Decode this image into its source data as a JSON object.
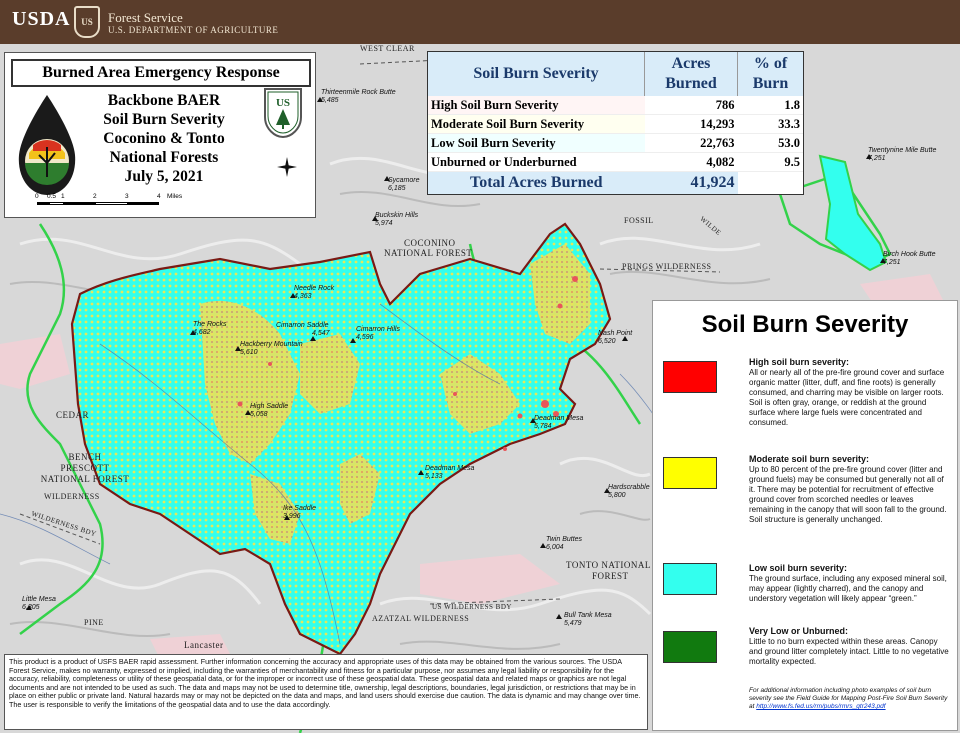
{
  "header": {
    "agency": "USDA",
    "shield_text": "US",
    "forest_service": "Forest Service",
    "department": "U.S. DEPARTMENT OF AGRICULTURE"
  },
  "title_panel": {
    "program": "Burned Area Emergency Response",
    "title_lines": [
      "Backbone BAER",
      "Soil Burn Severity",
      "Coconino & Tonto",
      "National Forests",
      "July 5, 2021"
    ],
    "baer_logo_text": "BURNED AREA EMERGENCY RESPONSE",
    "fs_logo_text": "FOREST SERVICE",
    "scale_labels": [
      "0",
      "0.5",
      "1",
      "2",
      "3",
      "4"
    ],
    "scale_unit": "Miles"
  },
  "severity_table": {
    "headers": [
      "Soil Burn Severity",
      "Acres Burned",
      "% of Burn"
    ],
    "rows": [
      {
        "label": "High Soil Burn Severity",
        "acres": "786",
        "pct": "1.8"
      },
      {
        "label": "Moderate Soil Burn Severity",
        "acres": "14,293",
        "pct": "33.3"
      },
      {
        "label": "Low Soil Burn Severity",
        "acres": "22,763",
        "pct": "53.0"
      },
      {
        "label": "Unburned or Underburned",
        "acres": "4,082",
        "pct": "9.5"
      }
    ],
    "total_label": "Total Acres Burned",
    "total_acres": "41,924"
  },
  "legend": {
    "title": "Soil Burn Severity",
    "items": [
      {
        "color": "#ff0000",
        "heading": "High soil burn severity:",
        "text": "All or nearly all of the pre-fire ground cover and surface organic matter (litter, duff, and fine roots) is generally consumed, and charring may be visible on larger roots. Soil is often gray, orange, or reddish at the ground surface where large fuels were concentrated and consumed."
      },
      {
        "color": "#ffff00",
        "heading": "Moderate soil burn severity:",
        "text": "Up to 80 percent of the pre-fire ground cover (litter and ground fuels) may be consumed but generally not all of it. There may be potential for recruitment of effective ground cover from scorched needles or leaves remaining in the canopy that will soon fall to the ground. Soil structure is generally unchanged."
      },
      {
        "color": "#33ffee",
        "heading": "Low soil burn severity:",
        "text": "The ground surface, including any exposed mineral soil, may appear (lightly charred), and the canopy and understory vegetation will likely appear “green.”"
      },
      {
        "color": "#117a0f",
        "heading": "Very Low or Unburned:",
        "text": "Little to no burn expected within these areas. Canopy and ground litter completely intact. Little to no vegetative mortality expected."
      }
    ],
    "note": "For additional information including photo examples of soil burn severity see the Field Guide for Mapping Post-Fire Soil Burn Severity at",
    "link": "http://www.fs.fed.us/rm/pubs/rmrs_gtr243.pdf"
  },
  "map_labels": {
    "peaks": [
      {
        "name": "Thirteenmile Rock Butte",
        "elev": "5,485"
      },
      {
        "name": "Sycamore",
        "elev": "6,185"
      },
      {
        "name": "Buckskin Hills",
        "elev": "5,974"
      },
      {
        "name": "Needle Rock",
        "elev": "4,363"
      },
      {
        "name": "The Rocks",
        "elev": "4,682"
      },
      {
        "name": "Cimarron Saddle",
        "elev": "4,547"
      },
      {
        "name": "Cimarron Hills",
        "elev": "4,596"
      },
      {
        "name": "Hackberry Mountain",
        "elev": "5,610"
      },
      {
        "name": "High Saddle",
        "elev": "5,058"
      },
      {
        "name": "Nash Point",
        "elev": "6,520"
      },
      {
        "name": "Deadman Mesa",
        "elev": "5,784"
      },
      {
        "name": "Deadman Mesa",
        "elev": "5,133"
      },
      {
        "name": "Ike Saddle",
        "elev": "3,996"
      },
      {
        "name": "Hardscrabble",
        "elev": "5,800"
      },
      {
        "name": "Twin Buttes",
        "elev": "6,004"
      },
      {
        "name": "Little Mesa",
        "elev": "6,305"
      },
      {
        "name": "Bull Tank Mesa",
        "elev": "5,479"
      },
      {
        "name": "Twentynine Mile Butte",
        "elev": "7,251"
      },
      {
        "name": "Birch Hook Butte",
        "elev": "7,251"
      }
    ],
    "areas": {
      "coconino": [
        "COCONINO",
        "NATIONAL FOREST"
      ],
      "prescott": [
        "BENCH",
        "PRESCOTT",
        "NATIONAL FOREST"
      ],
      "cedar": "CEDAR",
      "wilderness_left": "WILDERNESS",
      "tonto": [
        "TONTO NATIONAL",
        "FOREST"
      ],
      "fossil": "FOSSIL",
      "springs_wilderness": "PRINGS  WILDERNESS",
      "mazatzal": "AZATZAL  WILDERNESS",
      "mazatzal_bdy": "US WILDERNESS BDY",
      "pine": "PINE",
      "lancaster": "Lancaster",
      "wilderness_bdy_left": "WILDERNESS BDY",
      "west_clear": "WEST CLEAR",
      "wilderness_right": "WILDE"
    }
  },
  "disclaimer": "This product is a product of USFS BAER rapid assessment. Further information concerning the accuracy and appropriate uses of this data may be obtained from the various sources. The USDA Forest Service, makes no warranty, expressed or implied, including the warranties of merchantability and fitness for a particular purpose, nor assumes any legal liability or responsibility for the accuracy, reliability, completeness or utility of these geospatial data, or for the improper or incorrect use of these geospatial data. These geospatial data and related maps or graphics are not legal documents and are not intended to be used as such. The data and maps may not be used to determine title, ownership, legal descriptions, boundaries, legal jurisdiction, or restrictions that may be in place on either public or private land. Natural hazards may or may not be depicted on the data and maps, and land users should exercise due caution. The data is dynamic and may change over time. The user is responsible to verify the limitations of the geospatial data and to use the data accordingly."
}
